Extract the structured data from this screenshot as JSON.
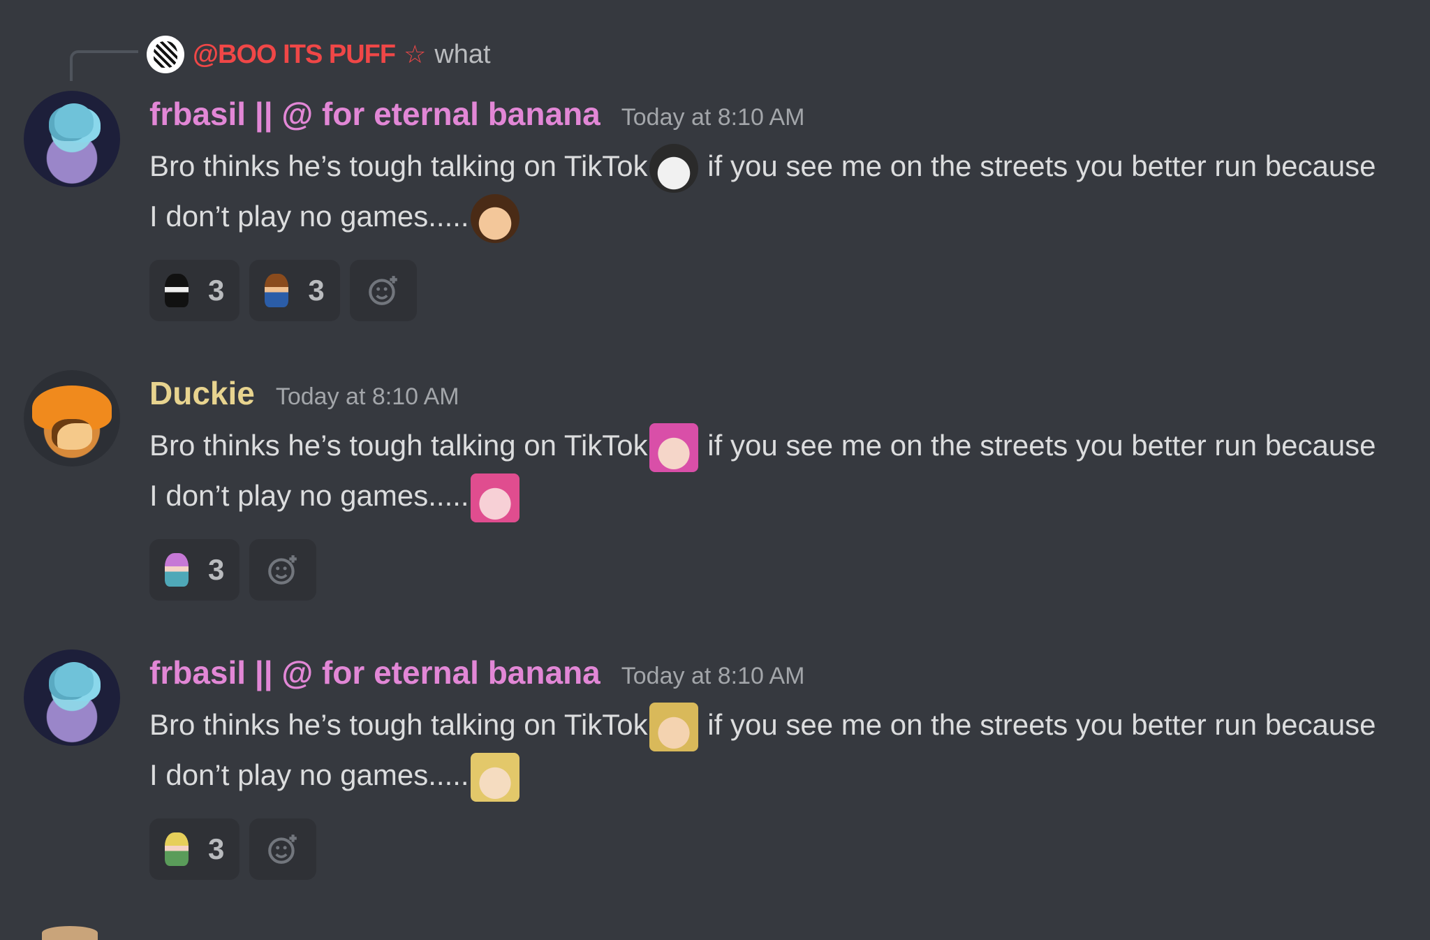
{
  "reply": {
    "username": "@BOO ITS PUFF",
    "star": "☆",
    "text": "what"
  },
  "messages": [
    {
      "username": "frbasil || @ for eternal banana",
      "timestamp": "Today at 8:10 AM",
      "line1_a": "Bro thinks he’s tough talking on TikTok",
      "line1_b": " if you see me on the streets you better run because",
      "line2": "I don’t play no games.....",
      "reactions": [
        {
          "emoji": "black-haired-sprite",
          "count": "3"
        },
        {
          "emoji": "brown-haired-sprite",
          "count": "3"
        }
      ]
    },
    {
      "username": "Duckie",
      "timestamp": "Today at 8:10 AM",
      "line1_a": "Bro thinks he’s tough talking on TikTok",
      "line1_b": "  if you see me on the streets you better run because",
      "line2": "I don’t play no games.....",
      "reactions": [
        {
          "emoji": "pink-haired-sprite",
          "count": "3"
        }
      ]
    },
    {
      "username": "frbasil || @ for eternal banana",
      "timestamp": "Today at 8:10 AM",
      "line1_a": "Bro thinks he’s tough talking on TikTok",
      "line1_b": " if you see me on the streets you better run because",
      "line2": "I don’t play no games.....",
      "reactions": [
        {
          "emoji": "blonde-haired-sprite",
          "count": "3"
        }
      ]
    }
  ],
  "colors": {
    "background": "#36393f",
    "basil_name": "#e287d6",
    "duckie_name": "#e8d48f",
    "reply_name": "#f04747",
    "reaction_bg": "#2f3136"
  }
}
